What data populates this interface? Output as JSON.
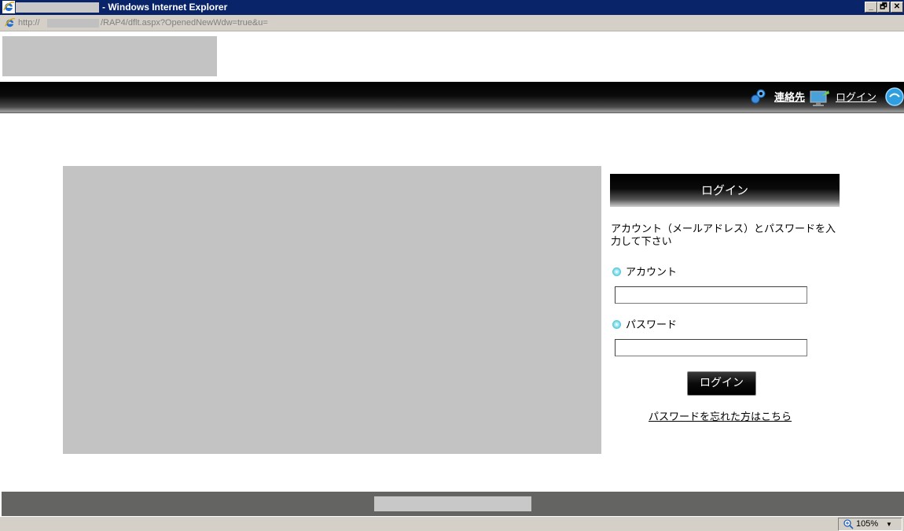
{
  "window": {
    "title": "- Windows Internet Explorer",
    "minimize": "_",
    "restore": "🗗",
    "close": "✕"
  },
  "address": {
    "scheme": "http://",
    "path": "/RAP4/dflt.aspx?OpenedNewWdw=true&u="
  },
  "nav": {
    "contact_label": "連絡先",
    "login_label": "ログイン"
  },
  "login": {
    "header": "ログイン",
    "instructions": "アカウント（メールアドレス）とパスワードを入力して下さい",
    "account_label": "アカウント",
    "account_value": "",
    "password_label": "パスワード",
    "password_value": "",
    "button_label": "ログイン",
    "forgot_label": "パスワードを忘れた方はこちら"
  },
  "status": {
    "zoom": "105%",
    "zoom_arrow": "▼"
  },
  "colors": {
    "titlebar": "#0a246a",
    "chrome": "#d4d0c8",
    "placeholder": "#c3c3c3",
    "footer": "#646462"
  }
}
